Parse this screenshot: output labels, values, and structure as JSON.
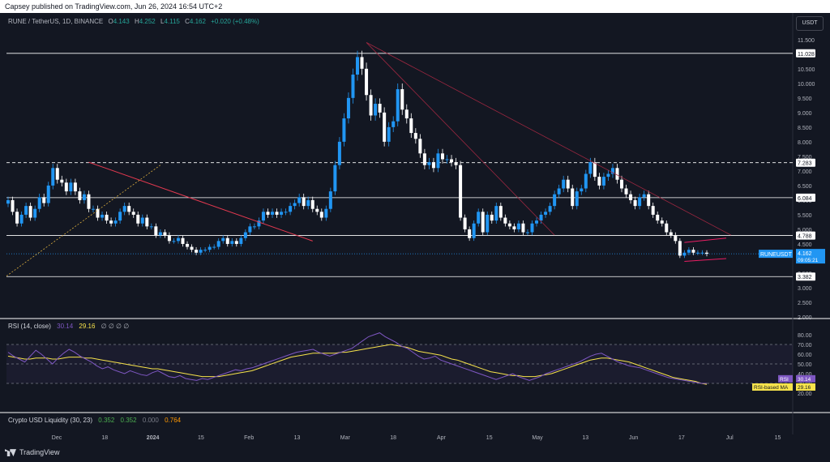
{
  "publisher": "Capsey published on TradingView.com, Jun 26, 2024 16:54 UTC+2",
  "legend": {
    "symbol": "RUNE / TetherUS, 1D, BINANCE",
    "o_label": "O",
    "o": "4.143",
    "h_label": "H",
    "h": "4.252",
    "l_label": "L",
    "l": "4.115",
    "c_label": "C",
    "c": "4.162",
    "change": "+0.020 (+0.48%)"
  },
  "currency": "USDT",
  "rsi_legend": {
    "title": "RSI (14, close)",
    "rsi": "30.14",
    "ma": "29.16",
    "extra": "∅ ∅ ∅ ∅"
  },
  "liq_legend": {
    "title": "Crypto USD Liquidity (30, 23)",
    "v1": "0.352",
    "v2": "0.352",
    "v3": "0.000",
    "v4": "0.764"
  },
  "footer": "TradingView",
  "chart_data": [
    {
      "type": "candlestick",
      "title": "RUNE / TetherUS, 1D, BINANCE",
      "ylim": [
        2.0,
        11.8
      ],
      "y_ticks": [
        "11.500",
        "11.000",
        "10.500",
        "10.000",
        "9.500",
        "9.000",
        "8.500",
        "8.000",
        "7.500",
        "7.000",
        "6.500",
        "6.000",
        "5.500",
        "5.000",
        "4.500",
        "4.000",
        "3.500",
        "3.000",
        "2.500",
        "2.000"
      ],
      "x_ticks": [
        "Dec",
        "18",
        "2024",
        "15",
        "Feb",
        "13",
        "Mar",
        "18",
        "Apr",
        "15",
        "May",
        "13",
        "Jun",
        "17",
        "Jul",
        "15"
      ],
      "close_series": [
        6.0,
        5.6,
        5.2,
        5.5,
        5.8,
        5.4,
        5.7,
        6.1,
        5.9,
        6.5,
        7.1,
        6.7,
        6.6,
        6.3,
        6.6,
        6.3,
        6.0,
        6.2,
        5.7,
        5.7,
        5.4,
        5.5,
        5.3,
        5.2,
        5.3,
        5.6,
        5.8,
        5.6,
        5.5,
        5.2,
        5.4,
        5.1,
        5.1,
        4.8,
        4.9,
        4.8,
        4.6,
        4.6,
        4.7,
        4.5,
        4.4,
        4.3,
        4.2,
        4.3,
        4.3,
        4.4,
        4.4,
        4.6,
        4.7,
        4.5,
        4.6,
        4.5,
        4.7,
        4.9,
        5.1,
        5.1,
        5.3,
        5.6,
        5.5,
        5.6,
        5.5,
        5.6,
        5.6,
        5.8,
        5.9,
        6.1,
        5.8,
        6.0,
        5.7,
        5.6,
        5.4,
        5.7,
        6.3,
        7.2,
        8.0,
        8.8,
        9.5,
        10.3,
        10.9,
        10.5,
        9.6,
        8.9,
        9.3,
        9.0,
        8.0,
        8.5,
        8.7,
        9.8,
        9.1,
        8.8,
        8.3,
        8.1,
        7.6,
        7.2,
        7.3,
        7.1,
        7.6,
        7.4,
        7.4,
        7.3,
        7.2,
        5.4,
        5.0,
        4.7,
        5.2,
        5.6,
        4.9,
        5.5,
        5.3,
        5.8,
        5.4,
        5.2,
        5.1,
        5.0,
        5.2,
        4.9,
        4.9,
        5.2,
        5.3,
        5.5,
        5.6,
        5.8,
        6.2,
        6.4,
        6.7,
        6.4,
        5.8,
        6.3,
        6.4,
        6.9,
        7.3,
        6.8,
        6.5,
        6.8,
        6.9,
        7.1,
        6.7,
        6.4,
        6.2,
        6.0,
        5.8,
        6.1,
        6.2,
        5.8,
        5.5,
        5.3,
        5.2,
        4.9,
        4.8,
        4.6,
        4.1,
        4.2,
        4.3,
        4.2,
        4.2,
        4.2,
        4.16
      ],
      "levels": [
        {
          "price": "11.028",
          "style": "solid"
        },
        {
          "price": "7.283",
          "style": "dashed"
        },
        {
          "price": "6.084",
          "style": "solid"
        },
        {
          "price": "4.788",
          "style": "solid"
        },
        {
          "price": "3.382",
          "style": "solid"
        }
      ],
      "last_price": {
        "label": "RUNEUSDT",
        "value": "4.162",
        "countdown": "09:05:21"
      }
    },
    {
      "type": "line",
      "title": "RSI (14, close)",
      "ylim": [
        0,
        90
      ],
      "y_ticks": [
        "80.00",
        "70.00",
        "60.00",
        "50.00",
        "40.00",
        "30.00",
        "20.00"
      ],
      "series": [
        {
          "name": "RSI",
          "color": "#7e57c2",
          "last": "30.14"
        },
        {
          "name": "RSI-based MA",
          "color": "#f7e34b",
          "last": "29.16"
        }
      ],
      "rsi": [
        62,
        58,
        55,
        52,
        58,
        64,
        60,
        55,
        50,
        56,
        61,
        65,
        62,
        58,
        55,
        52,
        48,
        45,
        47,
        44,
        42,
        40,
        43,
        41,
        39,
        38,
        41,
        43,
        40,
        37,
        36,
        38,
        35,
        34,
        33,
        35,
        34,
        36,
        38,
        40,
        42,
        44,
        43,
        45,
        46,
        48,
        50,
        52,
        54,
        56,
        58,
        60,
        62,
        63,
        64,
        65,
        62,
        60,
        58,
        60,
        62,
        64,
        66,
        70,
        74,
        78,
        80,
        82,
        78,
        75,
        72,
        68,
        66,
        62,
        58,
        55,
        56,
        58,
        54,
        52,
        50,
        48,
        46,
        44,
        42,
        40,
        38,
        36,
        34,
        36,
        38,
        40,
        37,
        35,
        33,
        35,
        37,
        40,
        42,
        44,
        46,
        48,
        50,
        52,
        55,
        58,
        60,
        61,
        58,
        55,
        52,
        50,
        48,
        47,
        46,
        44,
        42,
        40,
        38,
        36,
        35,
        34,
        33,
        32,
        31,
        30,
        30
      ],
      "ma": [
        58,
        57,
        56,
        55,
        55,
        56,
        56,
        56,
        55,
        55,
        56,
        57,
        57,
        57,
        56,
        56,
        55,
        54,
        53,
        52,
        51,
        50,
        49,
        48,
        47,
        46,
        45,
        45,
        44,
        43,
        42,
        41,
        40,
        39,
        38,
        37,
        37,
        37,
        37,
        38,
        39,
        40,
        41,
        42,
        43,
        45,
        47,
        49,
        51,
        53,
        55,
        57,
        58,
        59,
        60,
        61,
        61,
        61,
        61,
        61,
        62,
        62,
        63,
        64,
        65,
        66,
        67,
        68,
        69,
        70,
        69,
        68,
        67,
        65,
        63,
        62,
        61,
        60,
        59,
        57,
        55,
        54,
        52,
        50,
        48,
        46,
        44,
        42,
        41,
        40,
        39,
        38,
        38,
        37,
        37,
        37,
        38,
        39,
        40,
        42,
        44,
        46,
        48,
        50,
        52,
        54,
        55,
        56,
        56,
        55,
        54,
        53,
        52,
        50,
        48,
        46,
        44,
        42,
        40,
        38,
        36,
        35,
        34,
        33,
        32,
        30,
        29
      ],
      "ma_label": "RSI-based MA"
    }
  ]
}
